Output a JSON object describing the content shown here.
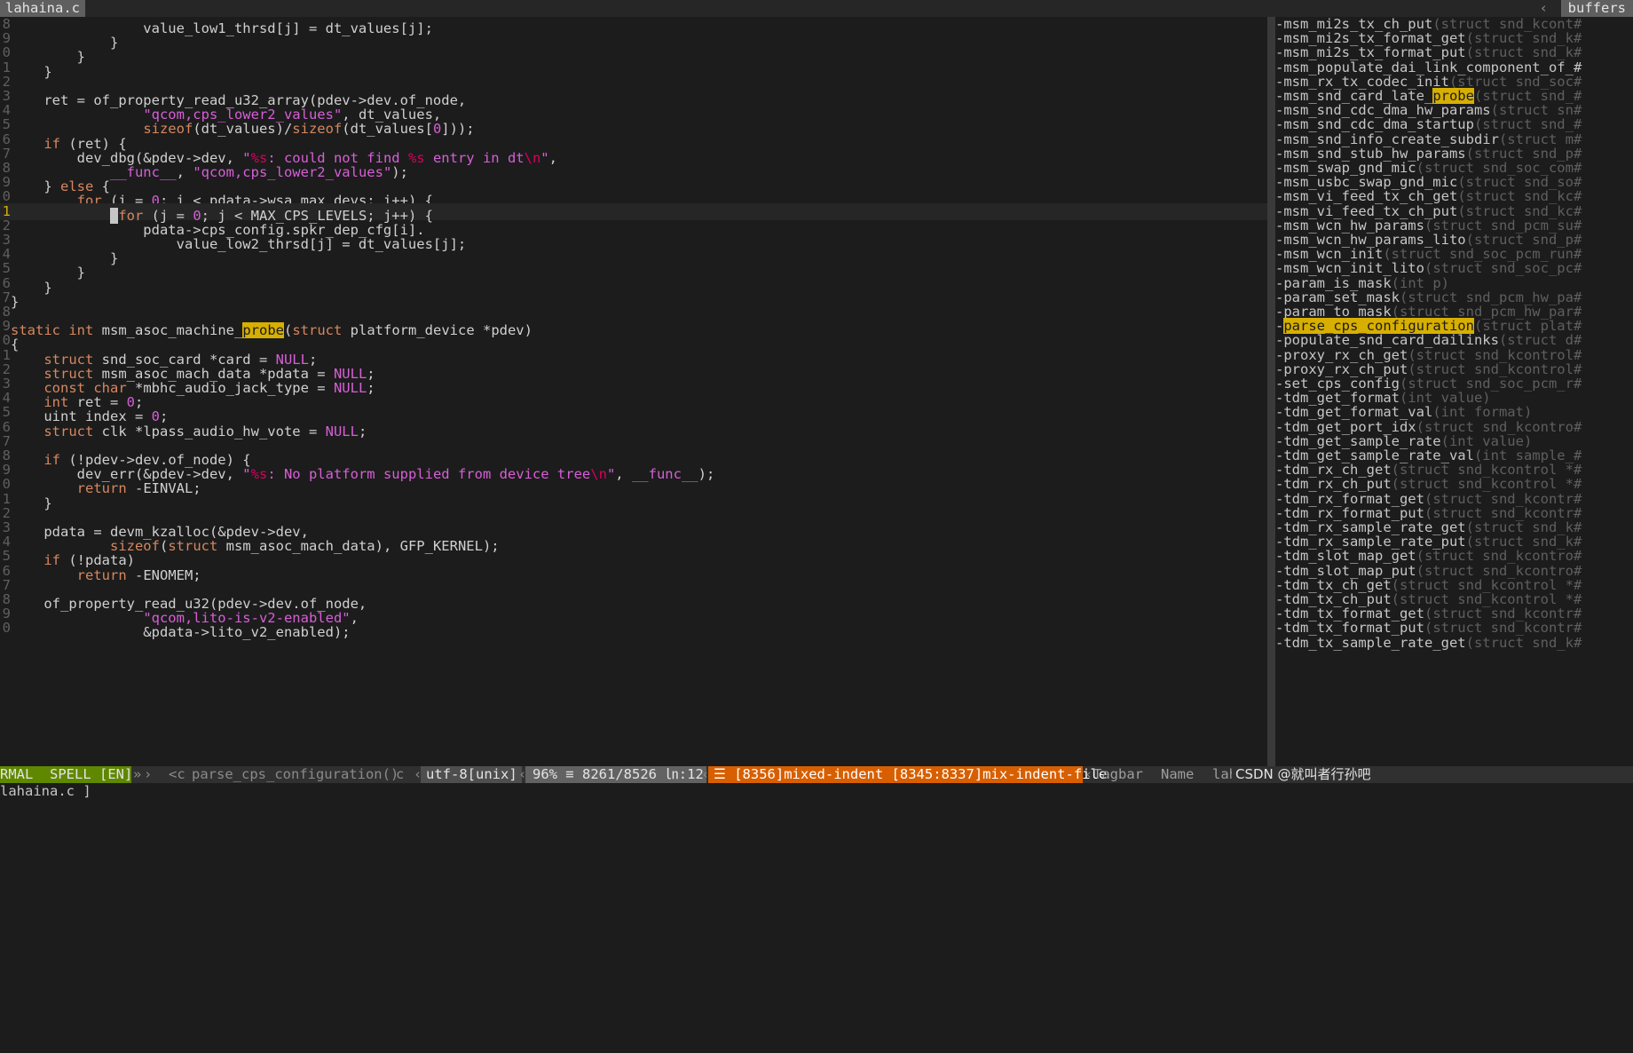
{
  "tabs": {
    "active": "lahaina.c",
    "right_sep": "‹",
    "right": "buffers"
  },
  "code_lines": [
    {
      "n": "8",
      "segs": [
        {
          "t": "                value_low1_thrsd[j] = dt_values[j];"
        }
      ]
    },
    {
      "n": "9",
      "segs": [
        {
          "t": "            }"
        }
      ]
    },
    {
      "n": "0",
      "segs": [
        {
          "t": "        }"
        }
      ]
    },
    {
      "n": "1",
      "segs": [
        {
          "t": "    }"
        }
      ]
    },
    {
      "n": "2",
      "segs": [
        {
          "t": ""
        }
      ]
    },
    {
      "n": "3",
      "segs": [
        {
          "t": "    ret = of_property_read_u32_array(pdev->dev.of_node,"
        }
      ]
    },
    {
      "n": "4",
      "segs": [
        {
          "t": "                "
        },
        {
          "t": "\"qcom,cps_lower2_values\"",
          "c": "str"
        },
        {
          "t": ", dt_values,"
        }
      ]
    },
    {
      "n": "5",
      "segs": [
        {
          "t": "                "
        },
        {
          "t": "sizeof",
          "c": "kw"
        },
        {
          "t": "(dt_values)/"
        },
        {
          "t": "sizeof",
          "c": "kw"
        },
        {
          "t": "(dt_values["
        },
        {
          "t": "0",
          "c": "num"
        },
        {
          "t": "]));"
        }
      ]
    },
    {
      "n": "6",
      "segs": [
        {
          "t": "    "
        },
        {
          "t": "if",
          "c": "kw"
        },
        {
          "t": " (ret) {"
        }
      ]
    },
    {
      "n": "7",
      "segs": [
        {
          "t": "        dev_dbg(&pdev->dev, "
        },
        {
          "t": "\"",
          "c": "str"
        },
        {
          "t": "%s",
          "c": "esc"
        },
        {
          "t": ": could not find ",
          "c": "str"
        },
        {
          "t": "%s",
          "c": "esc"
        },
        {
          "t": " entry in dt",
          "c": "str"
        },
        {
          "t": "\\n",
          "c": "esc"
        },
        {
          "t": "\"",
          "c": "str"
        },
        {
          "t": ","
        }
      ]
    },
    {
      "n": "8",
      "segs": [
        {
          "t": "            "
        },
        {
          "t": "__func__",
          "c": "mac"
        },
        {
          "t": ", "
        },
        {
          "t": "\"qcom,cps_lower2_values\"",
          "c": "str"
        },
        {
          "t": ");"
        }
      ]
    },
    {
      "n": "9",
      "segs": [
        {
          "t": "    } "
        },
        {
          "t": "else",
          "c": "kw"
        },
        {
          "t": " {"
        }
      ]
    },
    {
      "n": "0",
      "segs": [
        {
          "t": "        "
        },
        {
          "t": "for",
          "c": "kw"
        },
        {
          "t": " (i = "
        },
        {
          "t": "0",
          "c": "num"
        },
        {
          "t": "; i < pdata->wsa_max_devs; i++) {"
        }
      ]
    },
    {
      "n": "1",
      "cur": true,
      "segs": [
        {
          "t": "            "
        },
        {
          "t": " ",
          "c": "cursor"
        },
        {
          "t": "for",
          "c": "kw"
        },
        {
          "t": " (j = "
        },
        {
          "t": "0",
          "c": "num"
        },
        {
          "t": "; j < MAX_CPS_LEVELS; j++) {"
        }
      ]
    },
    {
      "n": "2",
      "segs": [
        {
          "t": "                pdata->cps_config.spkr_dep_cfg[i]."
        }
      ]
    },
    {
      "n": "3",
      "segs": [
        {
          "t": "                    value_low2_thrsd[j] = dt_values[j];"
        }
      ]
    },
    {
      "n": "4",
      "segs": [
        {
          "t": "            }"
        }
      ]
    },
    {
      "n": "5",
      "segs": [
        {
          "t": "        }"
        }
      ]
    },
    {
      "n": "6",
      "segs": [
        {
          "t": "    }"
        }
      ]
    },
    {
      "n": "7",
      "segs": [
        {
          "t": "}"
        }
      ]
    },
    {
      "n": "8",
      "segs": [
        {
          "t": ""
        }
      ]
    },
    {
      "n": "9",
      "segs": [
        {
          "t": "static",
          "c": "kw"
        },
        {
          "t": " "
        },
        {
          "t": "int",
          "c": "ty"
        },
        {
          "t": " msm_asoc_machine_"
        },
        {
          "t": "probe",
          "c": "hl"
        },
        {
          "t": "("
        },
        {
          "t": "struct",
          "c": "kw"
        },
        {
          "t": " platform_device *pdev)"
        }
      ]
    },
    {
      "n": "0",
      "segs": [
        {
          "t": "{"
        }
      ]
    },
    {
      "n": "1",
      "segs": [
        {
          "t": "    "
        },
        {
          "t": "struct",
          "c": "kw"
        },
        {
          "t": " snd_soc_card *card = "
        },
        {
          "t": "NULL",
          "c": "mac"
        },
        {
          "t": ";"
        }
      ]
    },
    {
      "n": "2",
      "segs": [
        {
          "t": "    "
        },
        {
          "t": "struct",
          "c": "kw"
        },
        {
          "t": " msm_asoc_mach_data *pdata = "
        },
        {
          "t": "NULL",
          "c": "mac"
        },
        {
          "t": ";"
        }
      ]
    },
    {
      "n": "3",
      "segs": [
        {
          "t": "    "
        },
        {
          "t": "const",
          "c": "kw"
        },
        {
          "t": " "
        },
        {
          "t": "char",
          "c": "ty"
        },
        {
          "t": " *mbhc_audio_jack_type = "
        },
        {
          "t": "NULL",
          "c": "mac"
        },
        {
          "t": ";"
        }
      ]
    },
    {
      "n": "4",
      "segs": [
        {
          "t": "    "
        },
        {
          "t": "int",
          "c": "ty"
        },
        {
          "t": " ret = "
        },
        {
          "t": "0",
          "c": "num"
        },
        {
          "t": ";"
        }
      ]
    },
    {
      "n": "5",
      "segs": [
        {
          "t": "    uint index = "
        },
        {
          "t": "0",
          "c": "num"
        },
        {
          "t": ";"
        }
      ]
    },
    {
      "n": "6",
      "segs": [
        {
          "t": "    "
        },
        {
          "t": "struct",
          "c": "kw"
        },
        {
          "t": " clk *lpass_audio_hw_vote = "
        },
        {
          "t": "NULL",
          "c": "mac"
        },
        {
          "t": ";"
        }
      ]
    },
    {
      "n": "7",
      "segs": [
        {
          "t": ""
        }
      ]
    },
    {
      "n": "8",
      "segs": [
        {
          "t": "    "
        },
        {
          "t": "if",
          "c": "kw"
        },
        {
          "t": " (!pdev->dev.of_node) {"
        }
      ]
    },
    {
      "n": "9",
      "segs": [
        {
          "t": "        dev_err(&pdev->dev, "
        },
        {
          "t": "\"",
          "c": "str"
        },
        {
          "t": "%s",
          "c": "esc"
        },
        {
          "t": ": No platform supplied from device tree",
          "c": "str"
        },
        {
          "t": "\\n",
          "c": "esc"
        },
        {
          "t": "\"",
          "c": "str"
        },
        {
          "t": ", "
        },
        {
          "t": "__func__",
          "c": "mac"
        },
        {
          "t": ");"
        }
      ]
    },
    {
      "n": "0",
      "segs": [
        {
          "t": "        "
        },
        {
          "t": "return",
          "c": "kw"
        },
        {
          "t": " -EINVAL;"
        }
      ]
    },
    {
      "n": "1",
      "segs": [
        {
          "t": "    }"
        }
      ]
    },
    {
      "n": "2",
      "segs": [
        {
          "t": ""
        }
      ]
    },
    {
      "n": "3",
      "segs": [
        {
          "t": "    pdata = devm_kzalloc(&pdev->dev,"
        }
      ]
    },
    {
      "n": "4",
      "segs": [
        {
          "t": "            "
        },
        {
          "t": "sizeof",
          "c": "kw"
        },
        {
          "t": "("
        },
        {
          "t": "struct",
          "c": "kw"
        },
        {
          "t": " msm_asoc_mach_data), GFP_KERNEL);"
        }
      ]
    },
    {
      "n": "5",
      "segs": [
        {
          "t": "    "
        },
        {
          "t": "if",
          "c": "kw"
        },
        {
          "t": " (!pdata)"
        }
      ]
    },
    {
      "n": "6",
      "segs": [
        {
          "t": "        "
        },
        {
          "t": "return",
          "c": "kw"
        },
        {
          "t": " -ENOMEM;"
        }
      ]
    },
    {
      "n": "7",
      "segs": [
        {
          "t": ""
        }
      ]
    },
    {
      "n": "8",
      "segs": [
        {
          "t": "    of_property_read_u32(pdev->dev.of_node,"
        }
      ]
    },
    {
      "n": "9",
      "segs": [
        {
          "t": "                "
        },
        {
          "t": "\"qcom,lito-is-v2-enabled\"",
          "c": "str"
        },
        {
          "t": ","
        }
      ]
    },
    {
      "n": "0",
      "segs": [
        {
          "t": "                &pdata->lito_v2_enabled);"
        }
      ]
    }
  ],
  "tag_lines": [
    {
      "name": "-msm_mi2s_tx_ch_put",
      "args": "(struct snd_kcont#"
    },
    {
      "name": "-msm_mi2s_tx_format_get",
      "args": "(struct snd_k#"
    },
    {
      "name": "-msm_mi2s_tx_format_put",
      "args": "(struct snd_k#"
    },
    {
      "name": "-msm_populate_dai_link_component_of_#",
      "args": ""
    },
    {
      "name": "-msm_rx_tx_codec_init",
      "args": "(struct snd_soc#"
    },
    {
      "name": "-msm_snd_card_late_",
      "hl": "probe",
      "args": "(struct snd_#"
    },
    {
      "name": "-msm_snd_cdc_dma_hw_params",
      "args": "(struct sn#"
    },
    {
      "name": "-msm_snd_cdc_dma_startup",
      "args": "(struct snd_#"
    },
    {
      "name": "-msm_snd_info_create_subdir",
      "args": "(struct m#"
    },
    {
      "name": "-msm_snd_stub_hw_params",
      "args": "(struct snd_p#"
    },
    {
      "name": "-msm_swap_gnd_mic",
      "args": "(struct snd_soc_com#"
    },
    {
      "name": "-msm_usbc_swap_gnd_mic",
      "args": "(struct snd_so#"
    },
    {
      "name": "-msm_vi_feed_tx_ch_get",
      "args": "(struct snd_kc#"
    },
    {
      "name": "-msm_vi_feed_tx_ch_put",
      "args": "(struct snd_kc#"
    },
    {
      "name": "-msm_wcn_hw_params",
      "args": "(struct snd_pcm_su#"
    },
    {
      "name": "-msm_wcn_hw_params_lito",
      "args": "(struct snd_p#"
    },
    {
      "name": "-msm_wcn_init",
      "args": "(struct snd_soc_pcm_run#"
    },
    {
      "name": "-msm_wcn_init_lito",
      "args": "(struct snd_soc_pc#"
    },
    {
      "name": "-param_is_mask",
      "args": "(int p)"
    },
    {
      "name": "-param_set_mask",
      "args": "(struct snd_pcm_hw_pa#"
    },
    {
      "name": "-param_to_mask",
      "args": "(struct snd_pcm_hw_par#"
    },
    {
      "name": "-",
      "sel": "parse_cps_configuration",
      "args": "(struct plat#"
    },
    {
      "name": "-populate_snd_card_dailinks",
      "args": "(struct d#"
    },
    {
      "name": "-proxy_rx_ch_get",
      "args": "(struct snd_kcontrol#"
    },
    {
      "name": "-proxy_rx_ch_put",
      "args": "(struct snd_kcontrol#"
    },
    {
      "name": "-set_cps_config",
      "args": "(struct snd_soc_pcm_r#"
    },
    {
      "name": "-tdm_get_format",
      "args": "(int value)"
    },
    {
      "name": "-tdm_get_format_val",
      "args": "(int format)"
    },
    {
      "name": "-tdm_get_port_idx",
      "args": "(struct snd_kcontro#"
    },
    {
      "name": "-tdm_get_sample_rate",
      "args": "(int value)"
    },
    {
      "name": "-tdm_get_sample_rate_val",
      "args": "(int sample_#"
    },
    {
      "name": "-tdm_rx_ch_get",
      "args": "(struct snd_kcontrol *#"
    },
    {
      "name": "-tdm_rx_ch_put",
      "args": "(struct snd_kcontrol *#"
    },
    {
      "name": "-tdm_rx_format_get",
      "args": "(struct snd_kcontr#"
    },
    {
      "name": "-tdm_rx_format_put",
      "args": "(struct snd_kcontr#"
    },
    {
      "name": "-tdm_rx_sample_rate_get",
      "args": "(struct snd_k#"
    },
    {
      "name": "-tdm_rx_sample_rate_put",
      "args": "(struct snd_k#"
    },
    {
      "name": "-tdm_slot_map_get",
      "args": "(struct snd_kcontro#"
    },
    {
      "name": "-tdm_slot_map_put",
      "args": "(struct snd_kcontro#"
    },
    {
      "name": "-tdm_tx_ch_get",
      "args": "(struct snd_kcontrol *#"
    },
    {
      "name": "-tdm_tx_ch_put",
      "args": "(struct snd_kcontrol *#"
    },
    {
      "name": "-tdm_tx_format_get",
      "args": "(struct snd_kcontr#"
    },
    {
      "name": "-tdm_tx_format_put",
      "args": "(struct snd_kcontr#"
    },
    {
      "name": "-tdm_tx_sample_rate_get",
      "args": "(struct snd_k#"
    }
  ],
  "status": {
    "mode": "RMAL  SPELL [EN]",
    "arrow1": "»",
    "tagflag": "›  <c",
    "function": "parse_cps_configuration()",
    "filetype": "c",
    "sep1": "‹",
    "encoding": "utf-8[unix]",
    "sep2": "‹",
    "position": "96% ≡ 8261/8526 ㏑:12",
    "sep3": "‹",
    "warning": "☰ [8356]mixed-indent [8345:8337]mix-indent-file",
    "sep4": "‹",
    "tagbar": "Tagbar",
    "tagbar_name": "Name",
    "tagbar_file": "lah",
    "watermark": "CSDN @就叫者行孙吧"
  },
  "cmdline": "lahaina.c ]",
  "colors": {
    "accent": "#d7af00",
    "warning_bg": "#d75f00",
    "status_bg": "#303030",
    "bg": "#1c1c1c"
  }
}
